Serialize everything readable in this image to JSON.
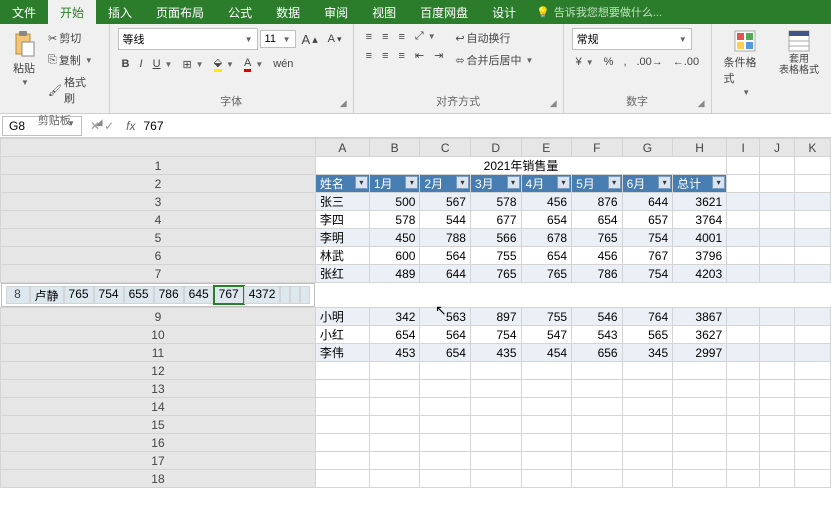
{
  "tabs": {
    "file": "文件",
    "home": "开始",
    "insert": "插入",
    "layout": "页面布局",
    "formula": "公式",
    "data": "数据",
    "review": "审阅",
    "view": "视图",
    "baidu": "百度网盘",
    "design": "设计",
    "tell": "告诉我您想要做什么..."
  },
  "ribbon": {
    "paste": "粘贴",
    "cut": "剪切",
    "copy": "复制",
    "brush": "格式刷",
    "clipboard": "剪贴板",
    "font_name": "等线",
    "font_size": "11",
    "font_group": "字体",
    "wen": "wén",
    "wrap": "自动换行",
    "merge": "合并后居中",
    "align_group": "对齐方式",
    "num_format": "常规",
    "num_group": "数字",
    "cond": "条件格式",
    "table": "套用\n表格格式"
  },
  "fbar": {
    "cell": "G8",
    "formula": "767"
  },
  "cols": [
    "A",
    "B",
    "C",
    "D",
    "E",
    "F",
    "G",
    "H",
    "I",
    "J",
    "K"
  ],
  "title_cell": "2021年销售量",
  "headers": [
    "姓名",
    "1月",
    "2月",
    "3月",
    "4月",
    "5月",
    "6月",
    "总计"
  ],
  "rows": [
    {
      "n": "张三",
      "v": [
        500,
        567,
        578,
        456,
        876,
        644,
        3621
      ]
    },
    {
      "n": "李四",
      "v": [
        578,
        544,
        677,
        654,
        654,
        657,
        3764
      ]
    },
    {
      "n": "李明",
      "v": [
        450,
        788,
        566,
        678,
        765,
        754,
        4001
      ]
    },
    {
      "n": "林武",
      "v": [
        600,
        564,
        755,
        654,
        456,
        767,
        3796
      ]
    },
    {
      "n": "张红",
      "v": [
        489,
        644,
        765,
        765,
        786,
        754,
        4203
      ]
    },
    {
      "n": "卢静",
      "v": [
        765,
        754,
        655,
        786,
        645,
        767,
        4372
      ]
    },
    {
      "n": "小明",
      "v": [
        342,
        563,
        897,
        755,
        546,
        764,
        3867
      ]
    },
    {
      "n": "小红",
      "v": [
        654,
        564,
        754,
        547,
        543,
        565,
        3627
      ]
    },
    {
      "n": "李伟",
      "v": [
        453,
        654,
        435,
        454,
        656,
        345,
        2997
      ]
    }
  ],
  "sel_row": 8,
  "sel_col": 7
}
